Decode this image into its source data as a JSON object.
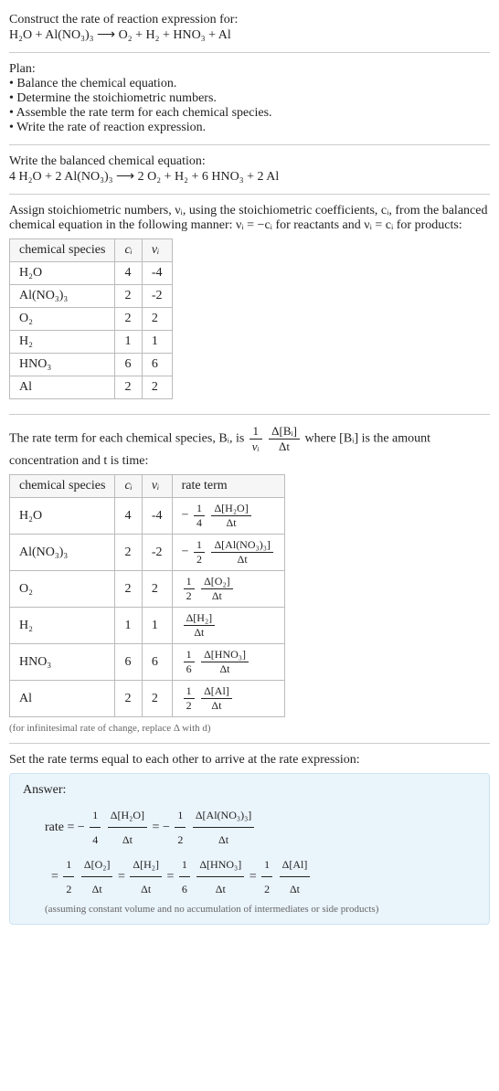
{
  "intro": {
    "line1": "Construct the rate of reaction expression for:",
    "equation": "H₂O + Al(NO₃)₃ ⟶ O₂ + H₂ + HNO₃ + Al"
  },
  "plan": {
    "heading": "Plan:",
    "items": [
      "Balance the chemical equation.",
      "Determine the stoichiometric numbers.",
      "Assemble the rate term for each chemical species.",
      "Write the rate of reaction expression."
    ]
  },
  "balanced": {
    "heading": "Write the balanced chemical equation:",
    "equation": "4 H₂O + 2 Al(NO₃)₃ ⟶ 2 O₂ + H₂ + 6 HNO₃ + 2 Al"
  },
  "stoich": {
    "text": "Assign stoichiometric numbers, νᵢ, using the stoichiometric coefficients, cᵢ, from the balanced chemical equation in the following manner: νᵢ = −cᵢ for reactants and νᵢ = cᵢ for products:",
    "headers": [
      "chemical species",
      "cᵢ",
      "νᵢ"
    ],
    "rows": [
      {
        "s": "H₂O",
        "c": "4",
        "v": "-4"
      },
      {
        "s": "Al(NO₃)₃",
        "c": "2",
        "v": "-2"
      },
      {
        "s": "O₂",
        "c": "2",
        "v": "2"
      },
      {
        "s": "H₂",
        "c": "1",
        "v": "1"
      },
      {
        "s": "HNO₃",
        "c": "6",
        "v": "6"
      },
      {
        "s": "Al",
        "c": "2",
        "v": "2"
      }
    ]
  },
  "rateterm": {
    "text_a": "The rate term for each chemical species, Bᵢ, is ",
    "text_b": " where [Bᵢ] is the amount concentration and t is time:",
    "frac_outer_num": "1",
    "frac_outer_den": "νᵢ",
    "frac_inner_num": "Δ[Bᵢ]",
    "frac_inner_den": "Δt",
    "headers": [
      "chemical species",
      "cᵢ",
      "νᵢ",
      "rate term"
    ],
    "rows": [
      {
        "s": "H₂O",
        "c": "4",
        "v": "-4",
        "coef_num": "1",
        "coef_den": "4",
        "neg": "−",
        "dnum": "Δ[H₂O]",
        "dden": "Δt"
      },
      {
        "s": "Al(NO₃)₃",
        "c": "2",
        "v": "-2",
        "coef_num": "1",
        "coef_den": "2",
        "neg": "−",
        "dnum": "Δ[Al(NO₃)₃]",
        "dden": "Δt"
      },
      {
        "s": "O₂",
        "c": "2",
        "v": "2",
        "coef_num": "1",
        "coef_den": "2",
        "neg": "",
        "dnum": "Δ[O₂]",
        "dden": "Δt"
      },
      {
        "s": "H₂",
        "c": "1",
        "v": "1",
        "coef_num": "",
        "coef_den": "",
        "neg": "",
        "dnum": "Δ[H₂]",
        "dden": "Δt"
      },
      {
        "s": "HNO₃",
        "c": "6",
        "v": "6",
        "coef_num": "1",
        "coef_den": "6",
        "neg": "",
        "dnum": "Δ[HNO₃]",
        "dden": "Δt"
      },
      {
        "s": "Al",
        "c": "2",
        "v": "2",
        "coef_num": "1",
        "coef_den": "2",
        "neg": "",
        "dnum": "Δ[Al]",
        "dden": "Δt"
      }
    ],
    "note": "(for infinitesimal rate of change, replace Δ with d)"
  },
  "final": {
    "heading": "Set the rate terms equal to each other to arrive at the rate expression:",
    "answer_label": "Answer:",
    "rate_word": "rate",
    "terms": [
      {
        "neg": "−",
        "coef_num": "1",
        "coef_den": "4",
        "dnum": "Δ[H₂O]",
        "dden": "Δt"
      },
      {
        "neg": "−",
        "coef_num": "1",
        "coef_den": "2",
        "dnum": "Δ[Al(NO₃)₃]",
        "dden": "Δt"
      },
      {
        "neg": "",
        "coef_num": "1",
        "coef_den": "2",
        "dnum": "Δ[O₂]",
        "dden": "Δt"
      },
      {
        "neg": "",
        "coef_num": "",
        "coef_den": "",
        "dnum": "Δ[H₂]",
        "dden": "Δt"
      },
      {
        "neg": "",
        "coef_num": "1",
        "coef_den": "6",
        "dnum": "Δ[HNO₃]",
        "dden": "Δt"
      },
      {
        "neg": "",
        "coef_num": "1",
        "coef_den": "2",
        "dnum": "Δ[Al]",
        "dden": "Δt"
      }
    ],
    "note": "(assuming constant volume and no accumulation of intermediates or side products)"
  }
}
